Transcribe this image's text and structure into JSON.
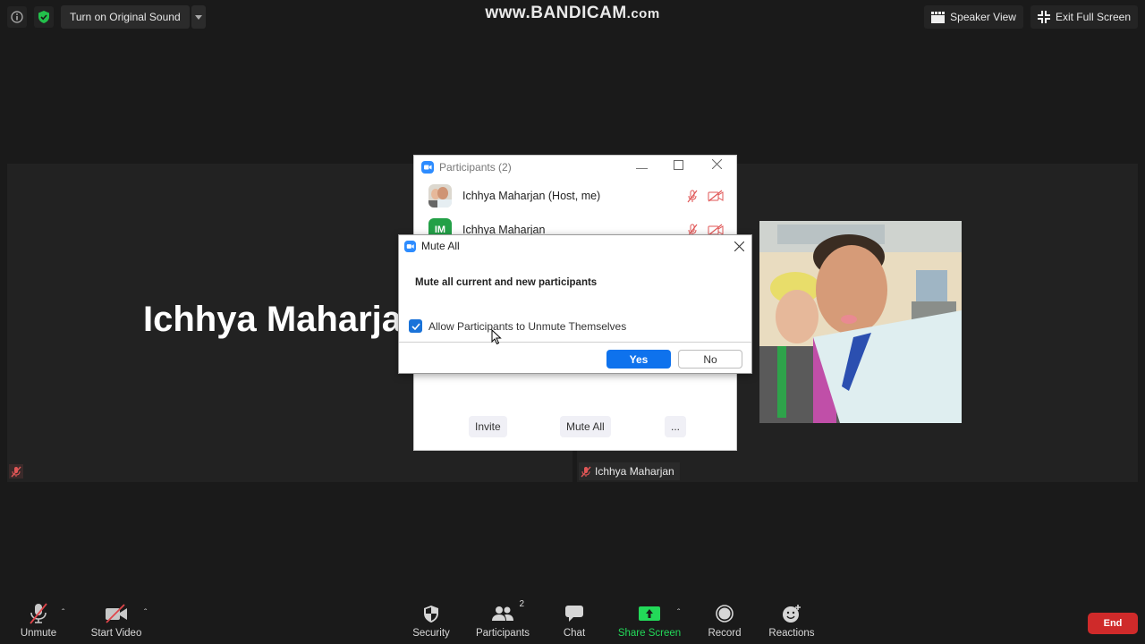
{
  "topbar": {
    "original_sound_label": "Turn on Original Sound",
    "watermark_main": "www.BANDICAM",
    "watermark_suffix": ".com",
    "speaker_view_label": "Speaker View",
    "exit_fullscreen_label": "Exit Full Screen"
  },
  "tiles": {
    "left_display_name": "Ichhya Maharja",
    "right_name_tag": "Ichhya Maharjan"
  },
  "participants_panel": {
    "title": "Participants (2)",
    "participants": [
      {
        "name": "Ichhya Maharjan (Host, me)",
        "avatar": "photo",
        "audio": "muted",
        "video": "off"
      },
      {
        "name": "Ichhya Maharjan",
        "avatar_initials": "IM",
        "audio": "muted",
        "video": "off"
      }
    ],
    "footer_buttons": {
      "invite": "Invite",
      "mute_all": "Mute All",
      "more": "..."
    }
  },
  "mute_all_dialog": {
    "title": "Mute All",
    "message": "Mute all current and new participants",
    "checkbox_label": "Allow Participants to Unmute Themselves",
    "checkbox_checked": true,
    "yes_label": "Yes",
    "no_label": "No"
  },
  "toolbar": {
    "unmute": "Unmute",
    "start_video": "Start Video",
    "security": "Security",
    "participants": "Participants",
    "participants_count": "2",
    "chat": "Chat",
    "share_screen": "Share Screen",
    "record": "Record",
    "reactions": "Reactions",
    "end": "End"
  },
  "colors": {
    "accent_blue": "#0e72ed",
    "share_green": "#23d959",
    "end_red": "#cf2a2a",
    "muted_red": "#e05656"
  }
}
